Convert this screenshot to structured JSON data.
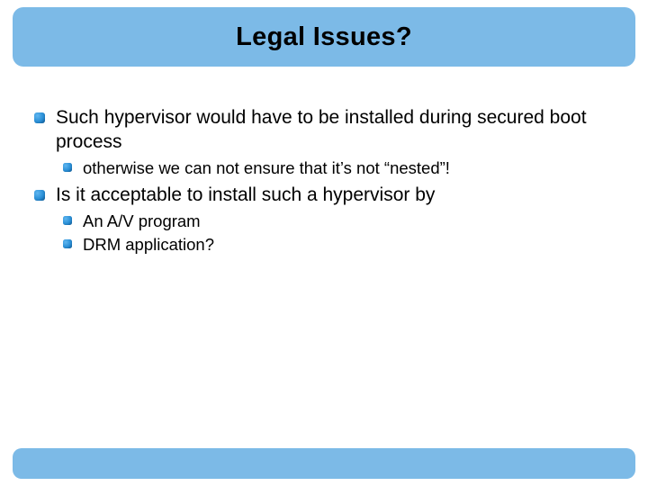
{
  "title": "Legal Issues?",
  "bullets": [
    {
      "text": "Such hypervisor would have to be installed during secured boot process",
      "children": [
        {
          "text": "otherwise we can not ensure that it’s not “nested”!"
        }
      ]
    },
    {
      "text": "Is it acceptable to install such a hypervisor by",
      "children": [
        {
          "text": "An A/V program"
        },
        {
          "text": "DRM application?"
        }
      ]
    }
  ]
}
